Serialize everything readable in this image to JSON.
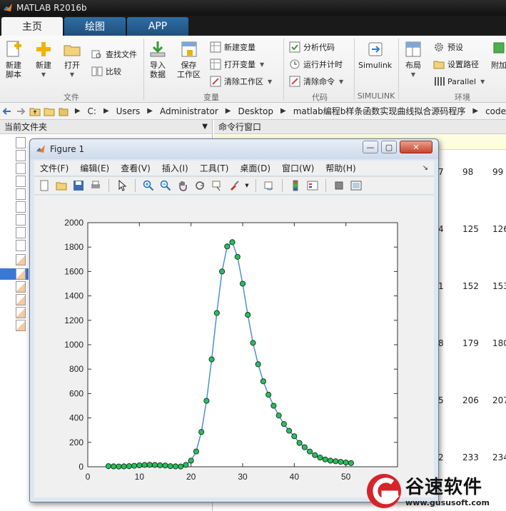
{
  "app": {
    "title": "MATLAB R2016b"
  },
  "tabs": [
    {
      "label": "主页",
      "active": true
    },
    {
      "label": "绘图",
      "active": false
    },
    {
      "label": "APP",
      "active": false
    }
  ],
  "ribbon": {
    "file_group": {
      "label": "文件",
      "new_script": "新建\n脚本",
      "new": "新建",
      "open": "打开",
      "find_files": "查找文件",
      "compare": "比较"
    },
    "variable_group": {
      "label": "变量",
      "import_data": "导入\n数据",
      "save_workspace": "保存\n工作区",
      "new_variable": "新建变量",
      "open_variable": "打开变量",
      "clear_workspace": "清除工作区"
    },
    "code_group": {
      "label": "代码",
      "analyze_code": "分析代码",
      "run_and_time": "运行并计时",
      "clear_commands": "清除命令"
    },
    "simulink_group": {
      "label": "SIMULINK",
      "simulink": "Simulink"
    },
    "environment_group": {
      "label": "环境",
      "layout": "布局",
      "preferences": "预设",
      "set_path": "设置路径",
      "parallel": "Parallel",
      "addons": "附加"
    }
  },
  "address": {
    "path": [
      "C:",
      "Users",
      "Administrator",
      "Desktop",
      "matlab编程b样条函数实现曲线拟合源码程序",
      "code"
    ]
  },
  "left_panel": {
    "title": "当前文件夹"
  },
  "right_panel": {
    "title": "命令行窗口",
    "rows": [
      [
        "7",
        "98",
        "99"
      ],
      [
        "4",
        "125",
        "126"
      ],
      [
        "1",
        "152",
        "153"
      ],
      [
        "8",
        "179",
        "180"
      ],
      [
        "5",
        "206",
        "207"
      ],
      [
        "2",
        "233",
        "234"
      ]
    ]
  },
  "figure": {
    "title": "Figure 1",
    "menu": [
      "文件(F)",
      "编辑(E)",
      "查看(V)",
      "插入(I)",
      "工具(T)",
      "桌面(D)",
      "窗口(W)",
      "帮助(H)"
    ],
    "menu_arrow": "↘"
  },
  "chart_data": {
    "type": "line",
    "title": "",
    "xlabel": "",
    "ylabel": "",
    "xlim": [
      0,
      60
    ],
    "ylim": [
      0,
      2000
    ],
    "xticks": [
      0,
      10,
      20,
      30,
      40,
      50
    ],
    "yticks": [
      0,
      200,
      400,
      600,
      800,
      1000,
      1200,
      1400,
      1600,
      1800,
      2000
    ],
    "grid": false,
    "series": [
      {
        "color": "#4a90d9",
        "marker_color": "#22c25a",
        "x": [
          4,
          5,
          6,
          7,
          8,
          9,
          10,
          11,
          12,
          13,
          14,
          15,
          16,
          17,
          18,
          19,
          20,
          21,
          22,
          23,
          24,
          25,
          26,
          27,
          28,
          29,
          30,
          31,
          32,
          33,
          34,
          35,
          36,
          37,
          38,
          39,
          40,
          41,
          42,
          43,
          44,
          45,
          46,
          47,
          48,
          49,
          50,
          51
        ],
        "y": [
          5,
          3,
          2,
          3,
          5,
          8,
          12,
          15,
          16,
          15,
          12,
          10,
          5,
          3,
          2,
          15,
          50,
          125,
          285,
          540,
          880,
          1260,
          1600,
          1805,
          1840,
          1720,
          1500,
          1245,
          1015,
          840,
          700,
          590,
          500,
          420,
          350,
          295,
          250,
          195,
          160,
          125,
          95,
          75,
          60,
          50,
          45,
          40,
          35,
          30
        ]
      }
    ]
  },
  "watermark": {
    "text": "谷速软件",
    "url": "www.gususoft.com"
  }
}
